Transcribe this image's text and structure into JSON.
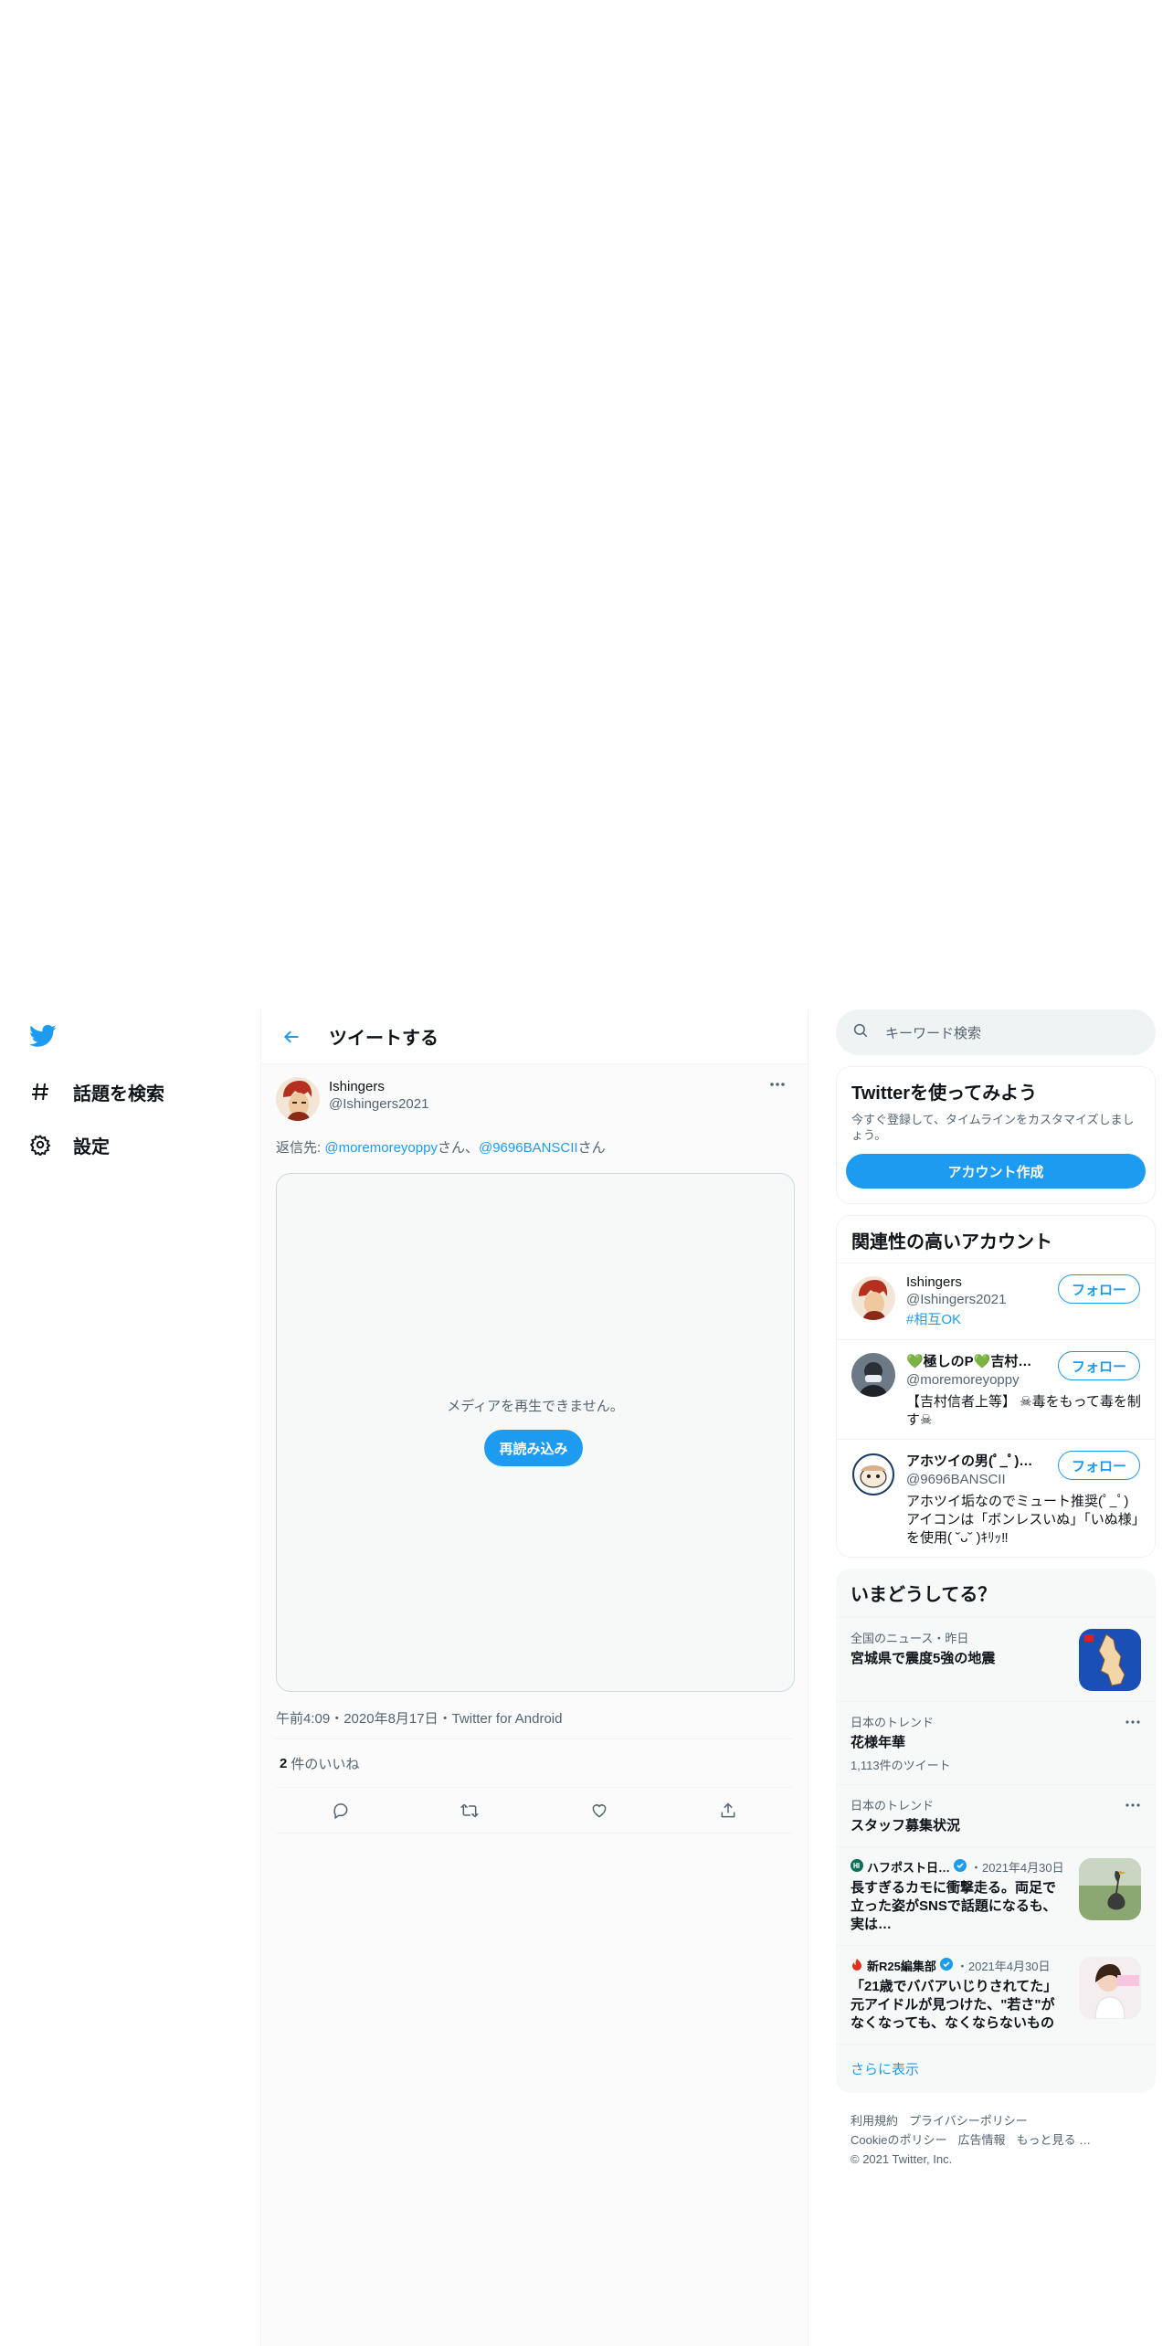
{
  "nav": {
    "explore_label": "話題を検索",
    "settings_label": "設定"
  },
  "header": {
    "title": "ツイートする"
  },
  "tweet": {
    "name": "Ishingers",
    "handle": "@Ishingers2021",
    "reply_prefix": "返信先: ",
    "reply_user1": "@moremoreyoppy",
    "reply_sep": "さん、",
    "reply_user2": "@9696BANSCII",
    "reply_suffix": "さん",
    "media_error": "メディアを再生できません。",
    "reload_label": "再読み込み",
    "meta": "午前4:09・2020年8月17日・Twitter for Android",
    "likes_count": "2",
    "likes_label": "件のいいね"
  },
  "search": {
    "placeholder": "キーワード検索"
  },
  "signup": {
    "title": "Twitterを使ってみよう",
    "desc": "今すぐ登録して、タイムラインをカスタマイズしましょう。",
    "button": "アカウント作成"
  },
  "relevant": {
    "title": "関連性の高いアカウント",
    "follow_label": "フォロー",
    "accounts": [
      {
        "name": "Ishingers",
        "handle": "@Ishingers2021",
        "bio": "#相互OK"
      },
      {
        "name": "💚極しのP💚吉村…",
        "handle": "@moremoreyoppy",
        "bio": "【吉村信者上等】 ☠毒をもって毒を制す☠"
      },
      {
        "name": "アホツイの男(ﾟ_ﾟ)…",
        "handle": "@9696BANSCII",
        "bio": "アホツイ垢なのでミュート推奨(ﾟ_ﾟ) アイコンは「ボンレスいぬ」「いぬ様」を使用( ˘ᴗ˘ )ｷﾘｯ‼"
      }
    ]
  },
  "trends": {
    "title": "いまどうしてる？",
    "items": [
      {
        "context": "全国のニュース・昨日",
        "title": "宮城県で震度5強の地震"
      },
      {
        "context": "日本のトレンド",
        "title": "花様年華",
        "count": "1,113件のツイート"
      },
      {
        "context": "日本のトレンド",
        "title": "スタッフ募集状況"
      }
    ],
    "news": [
      {
        "source": "ハフポスト日…",
        "date": "・2021年4月30日",
        "title": "長すぎるカモに衝撃走る。両足で立った姿がSNSで話題になるも、実は…"
      },
      {
        "source": "新R25編集部",
        "date": "・2021年4月30日",
        "title": "「21歳でババアいじりされてた」元アイドルが見つけた、\"若さ\"がなくなっても、なくならないもの"
      }
    ],
    "show_more": "さらに表示"
  },
  "footer": {
    "terms": "利用規約",
    "privacy": "プライバシーポリシー",
    "cookies": "Cookieのポリシー",
    "ads": "広告情報",
    "more": "もっと見る …",
    "copyright": "© 2021 Twitter, Inc."
  },
  "colors": {
    "accent": "#1d9bf0",
    "text": "#0f1419",
    "muted": "#536471"
  }
}
